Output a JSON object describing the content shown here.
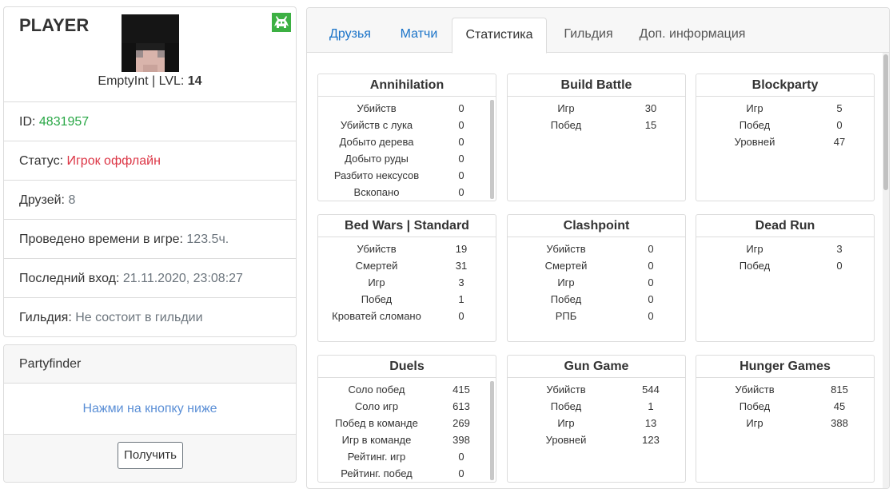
{
  "profile": {
    "title": "PLAYER",
    "username": "EmptyInt",
    "lvl_sep": " | LVL: ",
    "level": "14",
    "rows": [
      {
        "label": "ID: ",
        "value": "4831957"
      },
      {
        "label": "Статус: ",
        "value": "Игрок оффлайн"
      },
      {
        "label": "Друзей: ",
        "value": "8"
      },
      {
        "label": "Проведено времени в игре: ",
        "value": "123.5ч."
      },
      {
        "label": "Последний вход: ",
        "value": "21.11.2020, 23:08:27"
      },
      {
        "label": "Гильдия: ",
        "value": "Не состоит в гильдии"
      }
    ]
  },
  "partyfinder": {
    "header": "Partyfinder",
    "hint": "Нажми на кнопку ниже",
    "button": "Получить"
  },
  "tabs": [
    {
      "label": "Друзья"
    },
    {
      "label": "Матчи"
    },
    {
      "label": "Статистика",
      "active": true
    },
    {
      "label": "Гильдия"
    },
    {
      "label": "Доп. информация"
    }
  ],
  "games": [
    {
      "title": "Annihilation",
      "scrollable": true,
      "stats": [
        [
          "Убийств",
          "0"
        ],
        [
          "Убийств с лука",
          "0"
        ],
        [
          "Добыто дерева",
          "0"
        ],
        [
          "Добыто руды",
          "0"
        ],
        [
          "Разбито нексусов",
          "0"
        ],
        [
          "Вскопано",
          "0"
        ]
      ]
    },
    {
      "title": "Build Battle",
      "stats": [
        [
          "Игр",
          "30"
        ],
        [
          "Побед",
          "15"
        ]
      ]
    },
    {
      "title": "Blockparty",
      "stats": [
        [
          "Игр",
          "5"
        ],
        [
          "Побед",
          "0"
        ],
        [
          "Уровней",
          "47"
        ]
      ]
    },
    {
      "title": "Bed Wars | Standard",
      "stats": [
        [
          "Убийств",
          "19"
        ],
        [
          "Смертей",
          "31"
        ],
        [
          "Игр",
          "3"
        ],
        [
          "Побед",
          "1"
        ],
        [
          "Кроватей сломано",
          "0"
        ]
      ]
    },
    {
      "title": "Clashpoint",
      "stats": [
        [
          "Убийств",
          "0"
        ],
        [
          "Смертей",
          "0"
        ],
        [
          "Игр",
          "0"
        ],
        [
          "Побед",
          "0"
        ],
        [
          "РПБ",
          "0"
        ]
      ]
    },
    {
      "title": "Dead Run",
      "stats": [
        [
          "Игр",
          "3"
        ],
        [
          "Побед",
          "0"
        ]
      ]
    },
    {
      "title": "Duels",
      "scrollable": true,
      "stats": [
        [
          "Соло побед",
          "415"
        ],
        [
          "Соло игр",
          "613"
        ],
        [
          "Побед в команде",
          "269"
        ],
        [
          "Игр в команде",
          "398"
        ],
        [
          "Рейтинг. игр",
          "0"
        ],
        [
          "Рейтинг. побед",
          "0"
        ]
      ]
    },
    {
      "title": "Gun Game",
      "stats": [
        [
          "Убийств",
          "544"
        ],
        [
          "Побед",
          "1"
        ],
        [
          "Игр",
          "13"
        ],
        [
          "Уровней",
          "123"
        ]
      ]
    },
    {
      "title": "Hunger Games",
      "stats": [
        [
          "Убийств",
          "815"
        ],
        [
          "Побед",
          "45"
        ],
        [
          "Игр",
          "388"
        ]
      ]
    }
  ]
}
